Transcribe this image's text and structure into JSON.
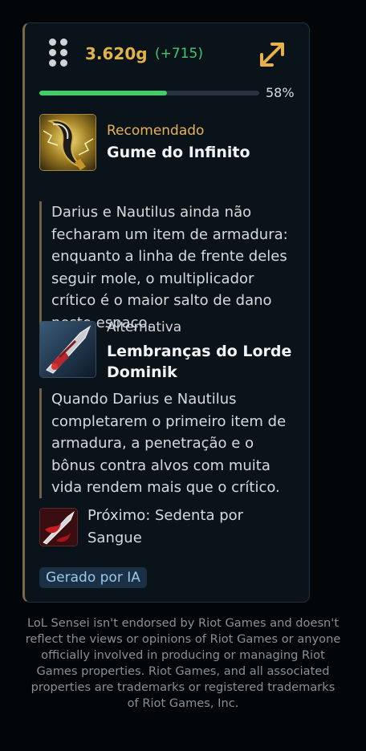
{
  "header": {
    "gold": "3.620g",
    "gold_delta": "(+715)",
    "progress_fraction": 0.58,
    "progress_label": "58%"
  },
  "recommended": {
    "label": "Recomendado",
    "item_name": "Gume do Infinito",
    "reason": "Darius e Nautilus ainda não fecharam um item de armadura: enquanto a linha de frente deles seguir mole, o multiplicador crítico é o maior salto de dano neste espaço."
  },
  "alternative": {
    "label": "Alternativa",
    "item_name": "Lembranças do Lorde Dominik",
    "reason": "Quando Darius e Nautilus completarem o primeiro item de armadura, a penetração e o bônus contra alvos com muita vida rendem mais que o crítico."
  },
  "next": {
    "text": "Próximo: Sedenta por Sangue"
  },
  "badge": {
    "label": "Gerado por IA"
  },
  "disclaimer": "LoL Sensei isn't endorsed by Riot Games and doesn't reflect the views or opinions of Riot Games or anyone officially involved in producing or managing Riot Games properties. Riot Games, and all associated properties are trademarks or registered trademarks of Riot Games, Inc.",
  "icons": {
    "drag": "drag-handle-icon",
    "expand": "expand-arrows-icon",
    "recommended_item": "infinity-edge-icon",
    "alternative_item": "lord-dominiks-regards-icon",
    "next_item": "bloodthirster-icon"
  },
  "colors": {
    "gold": "#e2b24b",
    "delta": "#40c870",
    "progress": "#3fcf6a",
    "recommended_label": "#e8b25a",
    "badge_text": "#9cc8ef"
  }
}
